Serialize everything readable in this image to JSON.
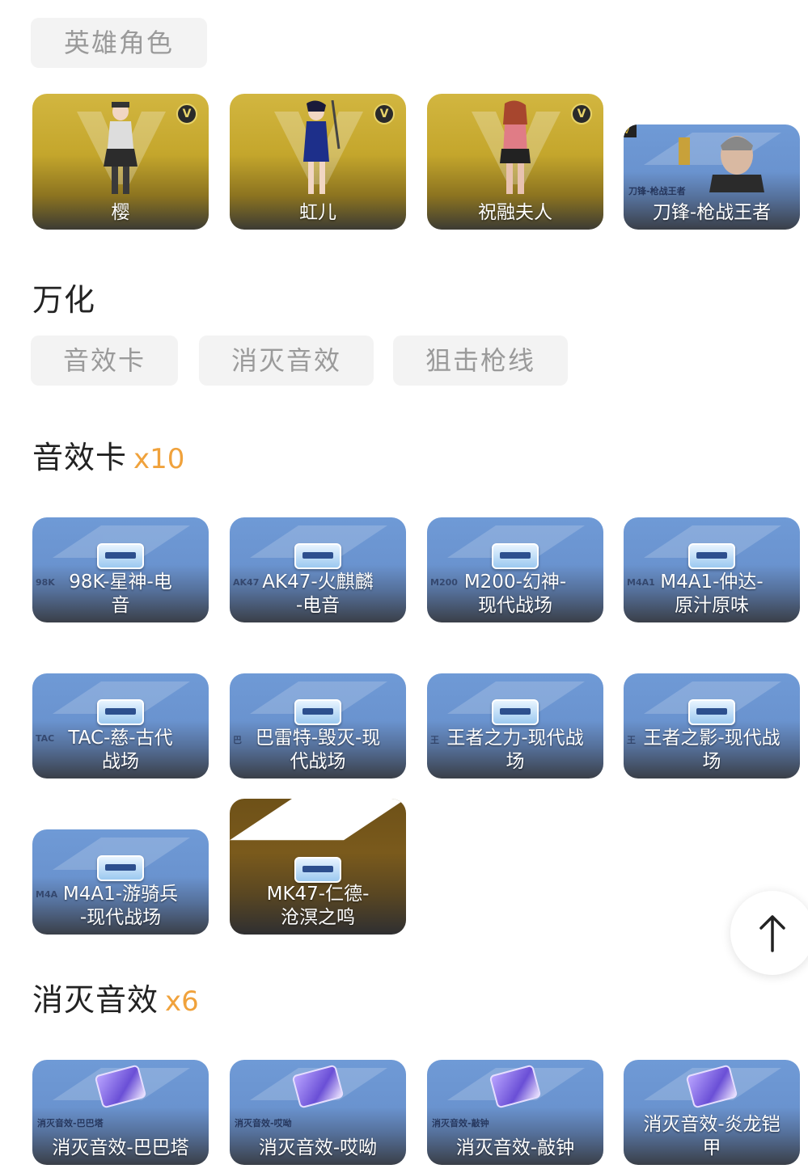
{
  "hero_tab": {
    "label": "英雄角色"
  },
  "heroes": [
    {
      "name": "樱",
      "style": "gold"
    },
    {
      "name": "虹儿",
      "style": "gold"
    },
    {
      "name": "祝融夫人",
      "style": "gold"
    },
    {
      "name": "刀锋-枪战王者",
      "style": "blue",
      "sub": "刀锋-枪战王者"
    }
  ],
  "wanhua": {
    "title": "万化",
    "tabs": [
      {
        "label": "音效卡"
      },
      {
        "label": "消灭音效"
      },
      {
        "label": "狙击枪线"
      }
    ]
  },
  "sound_cards": {
    "title": "音效卡",
    "count": "x10",
    "items": [
      {
        "line1": "98K-星神-电",
        "line2": "音",
        "prefix": "98K"
      },
      {
        "line1": "AK47-火麒麟",
        "line2": "-电音",
        "prefix": "AK47"
      },
      {
        "line1": "M200-幻神-",
        "line2": "现代战场",
        "prefix": "M200"
      },
      {
        "line1": "M4A1-仲达-",
        "line2": "原汁原味",
        "prefix": "M4A1"
      },
      {
        "line1": "TAC-慈-古代",
        "line2": "战场",
        "prefix": "TAC"
      },
      {
        "line1": "巴雷特-毁灭-现",
        "line2": "代战场",
        "prefix": "巴"
      },
      {
        "line1": "王者之力-现代战",
        "line2": "场",
        "prefix": "王"
      },
      {
        "line1": "王者之影-现代战",
        "line2": "场",
        "prefix": "王"
      },
      {
        "line1": "M4A1-游骑兵",
        "line2": "-现代战场",
        "prefix": "M4A"
      },
      {
        "line1": "MK47-仁德-",
        "line2": "沧溟之鸣",
        "prefix": ""
      }
    ]
  },
  "kill_sounds": {
    "title": "消灭音效",
    "count": "x6",
    "items": [
      {
        "line1": "消灭音效-巴巴塔",
        "line2": "",
        "sub": "消灭音效-巴巴塔"
      },
      {
        "line1": "消灭音效-哎呦",
        "line2": "",
        "sub": "消灭音效-哎呦"
      },
      {
        "line1": "消灭音效-敲钟",
        "line2": "",
        "sub": "消灭音效-敲钟"
      },
      {
        "line1": "消灭音效-炎龙铠",
        "line2": "甲",
        "sub": ""
      }
    ]
  },
  "colors": {
    "accent": "#f0a23c",
    "gold": "#c4a62c",
    "blue": "#6a93cf"
  },
  "icons": {
    "back_to_top": "arrow-up-icon",
    "vip": "v-badge-icon"
  }
}
